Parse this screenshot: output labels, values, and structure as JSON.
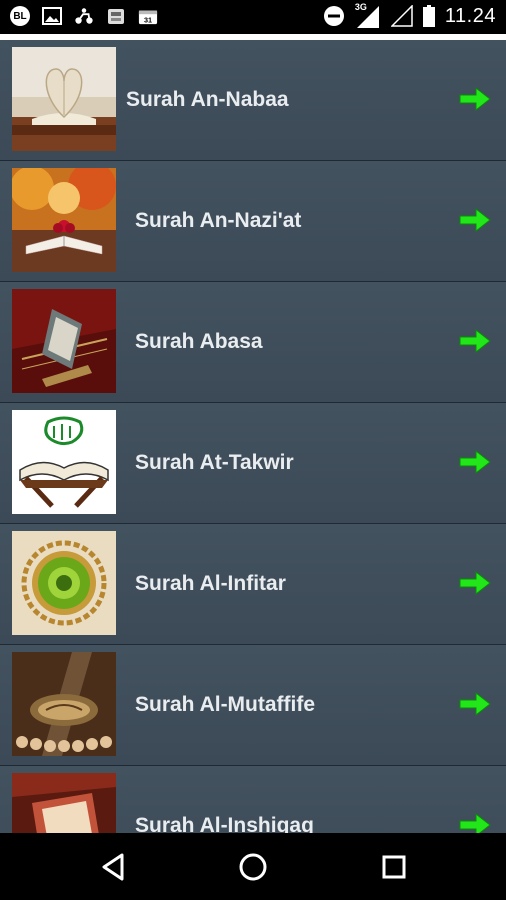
{
  "status": {
    "icons": [
      "bl-badge-icon",
      "image-icon",
      "scooter-icon",
      "app-icon",
      "calendar-icon"
    ],
    "left_badge": "BL",
    "network": "3G",
    "time": "11.24"
  },
  "list": {
    "items": [
      {
        "label": "Surah An-Nabaa",
        "thumb": "book-heart-thumbnail"
      },
      {
        "label": "Surah An-Nazi'at",
        "thumb": "quran-autumn-thumbnail"
      },
      {
        "label": "Surah Abasa",
        "thumb": "quran-stand-thumbnail"
      },
      {
        "label": "Surah At-Takwir",
        "thumb": "quran-calligraphy-thumbnail"
      },
      {
        "label": "Surah Al-Infitar",
        "thumb": "ornament-medallion-thumbnail"
      },
      {
        "label": "Surah Al-Mutaffife",
        "thumb": "quran-beads-thumbnail"
      },
      {
        "label": "Surah Al-Inshiqaq",
        "thumb": "quran-red-thumbnail"
      }
    ]
  },
  "colors": {
    "row_bg": "#3f4d5c",
    "arrow": "#22e51a",
    "label": "#e9edf0"
  }
}
